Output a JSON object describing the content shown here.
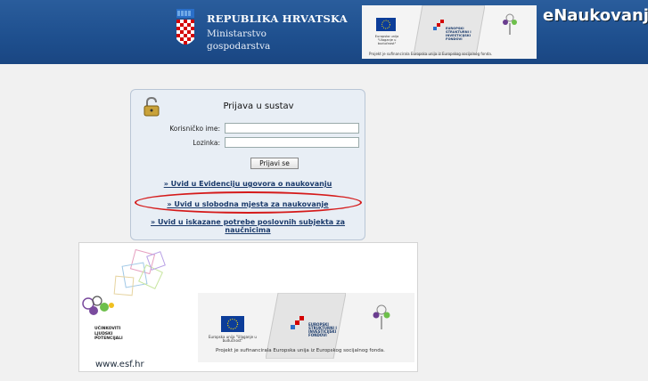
{
  "header": {
    "title_line1": "REPUBLIKA HRVATSKA",
    "title_line2": "Ministarstvo",
    "title_line3": "gospodarstva",
    "brand": "eNaukovanje",
    "banner": {
      "eu_caption": "Europska unija \"Ulaganje u budućnost\"",
      "structural_funds": "EUROPSKI STRUKTURNI I INVESTICIJSKI FONDOVI",
      "footer": "Projekt je sufinancirala Europska unija iz Europskog socijalnog fonda."
    }
  },
  "login": {
    "title": "Prijava u sustav",
    "username_label": "Korisničko ime:",
    "password_label": "Lozinka:",
    "submit_label": "Prijavi se",
    "link1": "» Uvid u Evidenciju ugovora o naukovanju",
    "link2": "» Uvid u slobodna mjesta za naukovanje",
    "link3_line1": "» Uvid u iskazane potrebe poslovnih subjekta za",
    "link3_line2": "naučnicima"
  },
  "esf": {
    "url": "www.esf.hr",
    "side_line1": "UČINKOVITI",
    "side_line2": "LJUDSKI",
    "side_line3": "POTENCIJALI",
    "banner_footer": "Projekt je sufinancirala Europska unija iz Europskog socijalnog fonda.",
    "eu_caption": "Europska unija \"Ulaganje u budućnost\"",
    "structural_funds": "EUROPSKI STRUKTURNI I INVESTICIJSKI FONDOVI"
  },
  "colors": {
    "header_blue": "#1e4f8e",
    "link": "#1a3a6b",
    "highlight": "#d51a1a"
  }
}
